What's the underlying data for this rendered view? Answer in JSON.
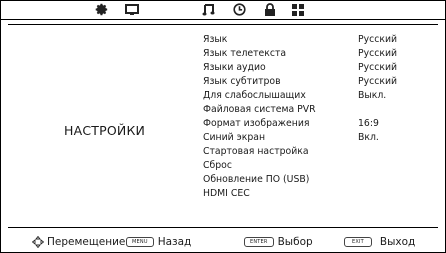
{
  "tabs": [
    {
      "icon": "gear-icon",
      "active": false
    },
    {
      "icon": "monitor-icon",
      "active": false
    },
    {
      "icon": "music-note-icon",
      "active": true
    },
    {
      "icon": "clock-icon",
      "active": false
    },
    {
      "icon": "lock-icon",
      "active": false
    },
    {
      "icon": "grid-icon",
      "active": false
    }
  ],
  "section_title": "НАСТРОЙКИ",
  "menu": [
    {
      "label": "Язык",
      "value": "Русский"
    },
    {
      "label": "Язык телетекста",
      "value": "Русский"
    },
    {
      "label": "Языки аудио",
      "value": "Русский"
    },
    {
      "label": "Язык субтитров",
      "value": "Русский"
    },
    {
      "label": "Для слабослышащих",
      "value": "Выкл."
    },
    {
      "label": "Файловая система PVR",
      "value": ""
    },
    {
      "label": "Формат изображения",
      "value": "16:9"
    },
    {
      "label": "Синий экран",
      "value": "Вкл."
    },
    {
      "label": "Стартовая настройка",
      "value": ""
    },
    {
      "label": "Сброс",
      "value": ""
    },
    {
      "label": "Обновление ПО (USB)",
      "value": ""
    },
    {
      "label": "HDMI CEC",
      "value": ""
    }
  ],
  "footer": {
    "move_label": "Перемещение",
    "menu_key": "MENU",
    "back_label": "Назад",
    "enter_key": "ENTER",
    "select_label": "Выбор",
    "exit_key": "EXIT",
    "exit_label": "Выход"
  }
}
